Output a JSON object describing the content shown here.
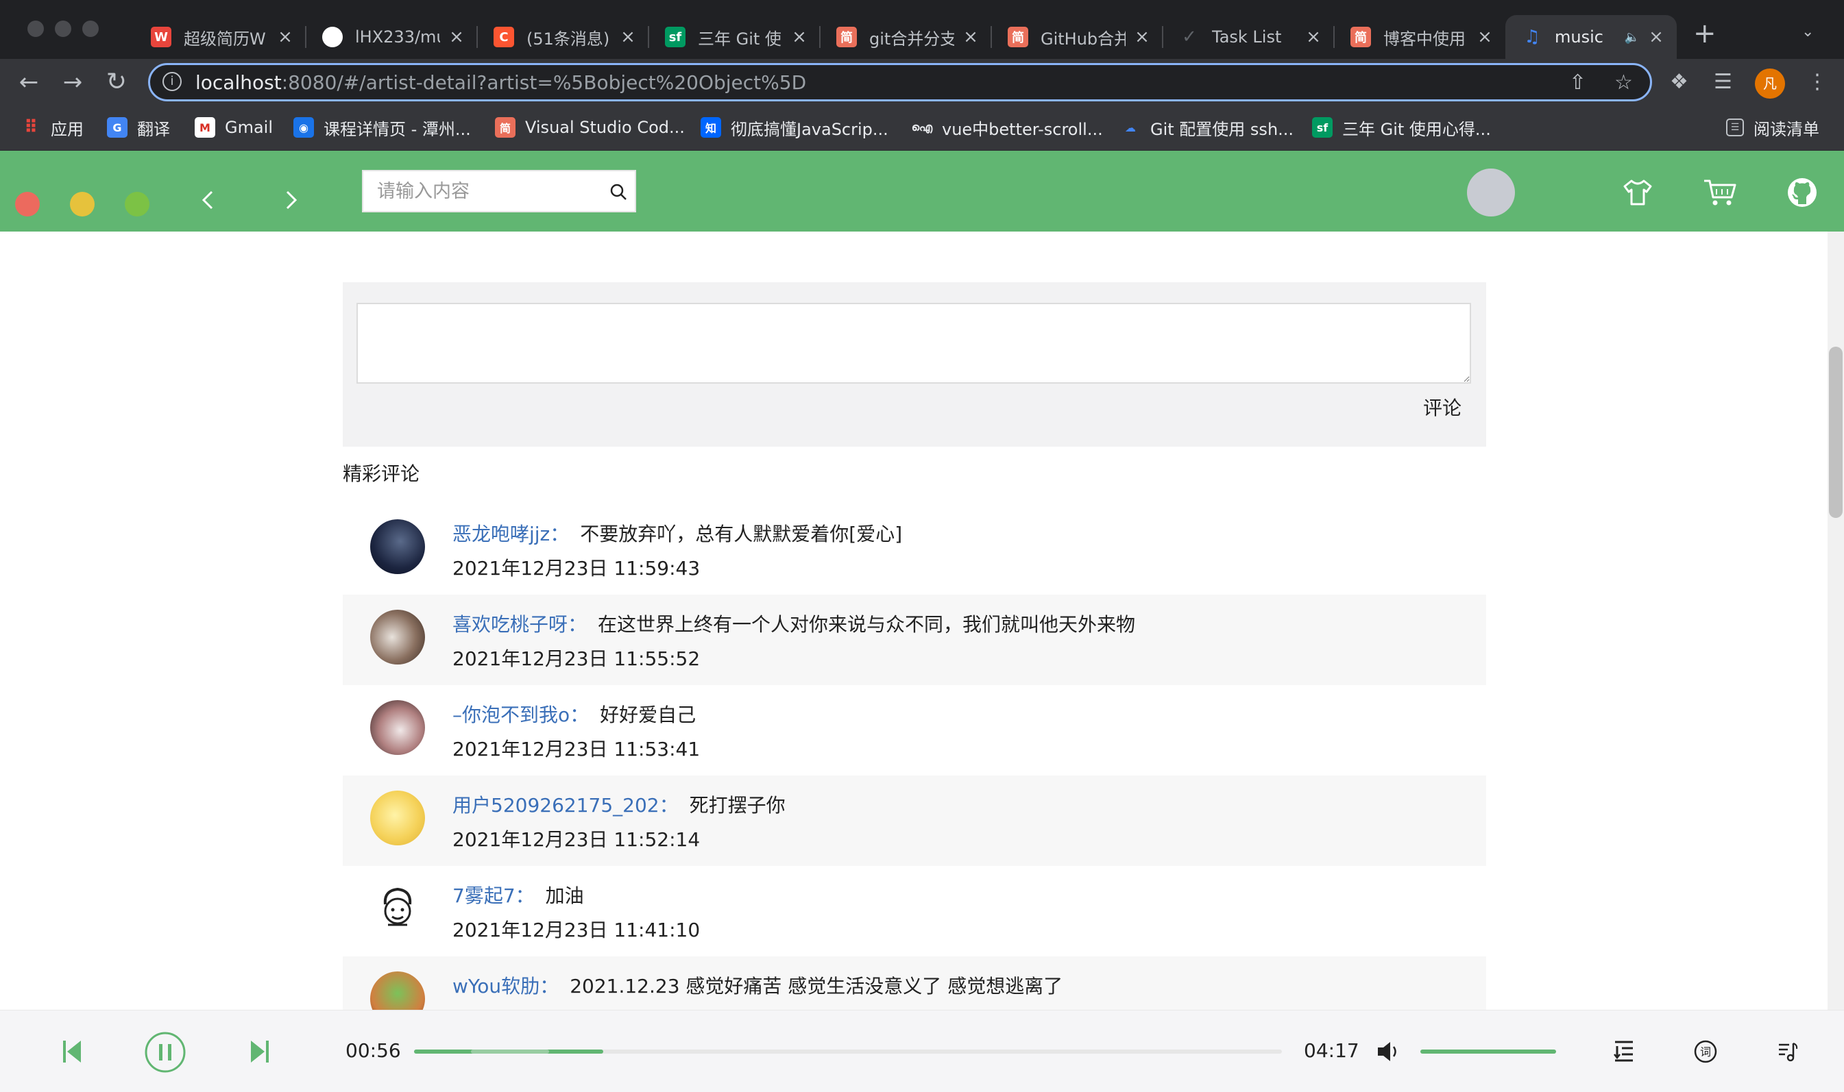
{
  "browser": {
    "tabs": [
      {
        "title": "超级简历W",
        "favicon": "resume-icon",
        "color": "#e8453c"
      },
      {
        "title": "lHX233/mu",
        "favicon": "github-icon",
        "color": "#ffffff"
      },
      {
        "title": "(51条消息)",
        "favicon": "csdn-icon",
        "color": "#fc5531"
      },
      {
        "title": "三年 Git 使",
        "favicon": "sf-icon",
        "color": "#009a61"
      },
      {
        "title": "git合并分支",
        "favicon": "jianshu-icon",
        "color": "#ea6f5a"
      },
      {
        "title": "GitHub合并",
        "favicon": "jianshu-icon",
        "color": "#ea6f5a"
      },
      {
        "title": "Task List",
        "favicon": "check-icon",
        "color": "#5f6368"
      },
      {
        "title": "博客中使用",
        "favicon": "jianshu-icon",
        "color": "#ea6f5a"
      },
      {
        "title": "music",
        "favicon": "music-note-icon",
        "color": "#4285f4"
      }
    ],
    "url_host": "localhost",
    "url_rest": ":8080/#/artist-detail?artist=%5Bobject%20Object%5D",
    "profile_initial": "凡",
    "bookmarks": [
      {
        "label": "应用",
        "icon": "apps-grid-icon"
      },
      {
        "label": "翻译",
        "icon": "translate-icon"
      },
      {
        "label": "Gmail",
        "icon": "gmail-icon"
      },
      {
        "label": "课程详情页 - 潭州...",
        "icon": "globe-icon"
      },
      {
        "label": "Visual Studio Cod...",
        "icon": "jianshu-icon"
      },
      {
        "label": "彻底搞懂JavaScrip...",
        "icon": "zhihu-icon"
      },
      {
        "label": "vue中better-scroll...",
        "icon": "bird-icon"
      },
      {
        "label": "Git 配置使用 ssh...",
        "icon": "cloud-icon"
      },
      {
        "label": "三年 Git 使用心得...",
        "icon": "sf-icon"
      }
    ],
    "reading_list": "阅读清单"
  },
  "header": {
    "search_placeholder": "请输入内容",
    "accent": "#61b672"
  },
  "comment_form": {
    "value": "",
    "submit_label": "评论"
  },
  "section_title": "精彩评论",
  "comments": [
    {
      "user": "恶龙咆哮jjz",
      "text": "不要放弃吖，总有人默默爱着你[爱心]",
      "time": "2021年12月23日 11:59:43"
    },
    {
      "user": "喜欢吃桃子呀",
      "text": "在这世界上终有一个人对你来说与众不同，我们就叫他天外来物",
      "time": "2021年12月23日 11:55:52"
    },
    {
      "user": "–你泡不到我o",
      "text": "好好爱自己",
      "time": "2021年12月23日 11:53:41"
    },
    {
      "user": "用户5209262175_202",
      "text": "死打摆子你",
      "time": "2021年12月23日 11:52:14"
    },
    {
      "user": "7雾起7",
      "text": "加油",
      "time": "2021年12月23日 11:41:10"
    },
    {
      "user": "wYou软肋",
      "text": "2021.12.23 感觉好痛苦 感觉生活没意义了 感觉想逃离了",
      "time": ""
    }
  ],
  "player": {
    "current_time": "00:56",
    "total_time": "04:17",
    "progress_fraction": 0.218,
    "buffered_fraction": 0.09,
    "volume_fraction": 1.0
  }
}
